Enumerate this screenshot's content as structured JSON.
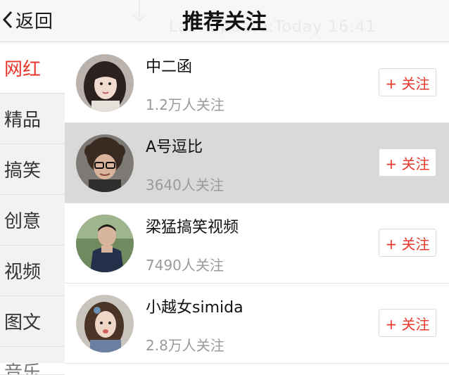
{
  "nav": {
    "back_label": "返回",
    "title": "推荐关注",
    "ghost_text": "Last update:Today 16:41"
  },
  "categories": [
    {
      "label": "网红",
      "active": true
    },
    {
      "label": "精品"
    },
    {
      "label": "搞笑"
    },
    {
      "label": "创意"
    },
    {
      "label": "视频"
    },
    {
      "label": "图文"
    },
    {
      "label": "音乐"
    }
  ],
  "users": [
    {
      "name": "中二函",
      "fans": "1.2万人关注",
      "follow": "+ 关注",
      "avatar": "female-portrait-1"
    },
    {
      "name": "A号逗比",
      "fans": "3640人关注",
      "follow": "+ 关注",
      "avatar": "curly-hair-glasses",
      "highlighted": true
    },
    {
      "name": "梁猛搞笑视频",
      "fans": "7490人关注",
      "follow": "+ 关注",
      "avatar": "male-outdoor"
    },
    {
      "name": "小越女simida",
      "fans": "2.8万人关注",
      "follow": "+ 关注",
      "avatar": "female-portrait-2"
    }
  ],
  "colors": {
    "accent": "#e8372c",
    "sidebar_bg": "#f2f2f2",
    "highlight_row": "#d9d9d9"
  }
}
